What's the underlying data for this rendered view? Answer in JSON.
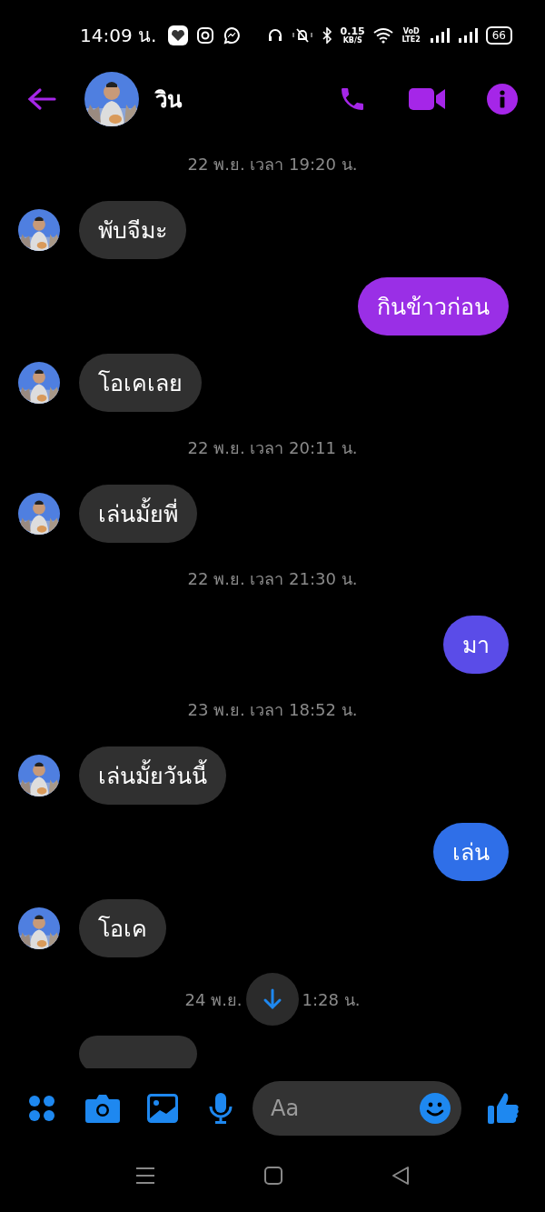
{
  "status_bar": {
    "time": "14:09 น.",
    "speed": "0.15",
    "speed_unit": "KB/S",
    "network": "VoD LTE2",
    "battery": "66"
  },
  "header": {
    "name": "วิน"
  },
  "messages": [
    {
      "kind": "timestamp",
      "text": "22 พ.ย. เวลา 19:20 น."
    },
    {
      "kind": "incoming",
      "text": "พับจีมะ"
    },
    {
      "kind": "outgoing",
      "text": "กินข้าวก่อน",
      "color": "#9a2fe6"
    },
    {
      "kind": "incoming",
      "text": "โอเคเลย"
    },
    {
      "kind": "timestamp",
      "text": "22 พ.ย. เวลา 20:11 น."
    },
    {
      "kind": "incoming",
      "text": "เล่นมั้ยพี่"
    },
    {
      "kind": "timestamp",
      "text": "22 พ.ย. เวลา 21:30 น."
    },
    {
      "kind": "outgoing",
      "text": "มา",
      "color": "#5a4ce8"
    },
    {
      "kind": "timestamp",
      "text": "23 พ.ย. เวลา 18:52 น."
    },
    {
      "kind": "incoming",
      "text": "เล่นมั้ยวันนี้"
    },
    {
      "kind": "outgoing",
      "text": "เล่น",
      "color": "#2f6fe8"
    },
    {
      "kind": "incoming",
      "text": "โอเค"
    },
    {
      "kind": "split_timestamp",
      "left": "24 พ.ย.",
      "right": "1:28 น."
    },
    {
      "kind": "cut_incoming"
    }
  ],
  "composer": {
    "placeholder": "Aa"
  }
}
